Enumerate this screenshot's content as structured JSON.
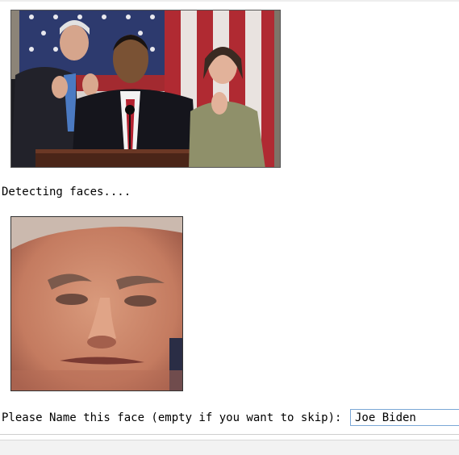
{
  "output": {
    "status_message": "Detecting faces....",
    "prompt_label": "Please Name this face (empty if you want to skip): "
  },
  "input": {
    "value": "Joe Biden"
  },
  "colors": {
    "input_border": "#7aa7d6",
    "background": "#ffffff"
  }
}
